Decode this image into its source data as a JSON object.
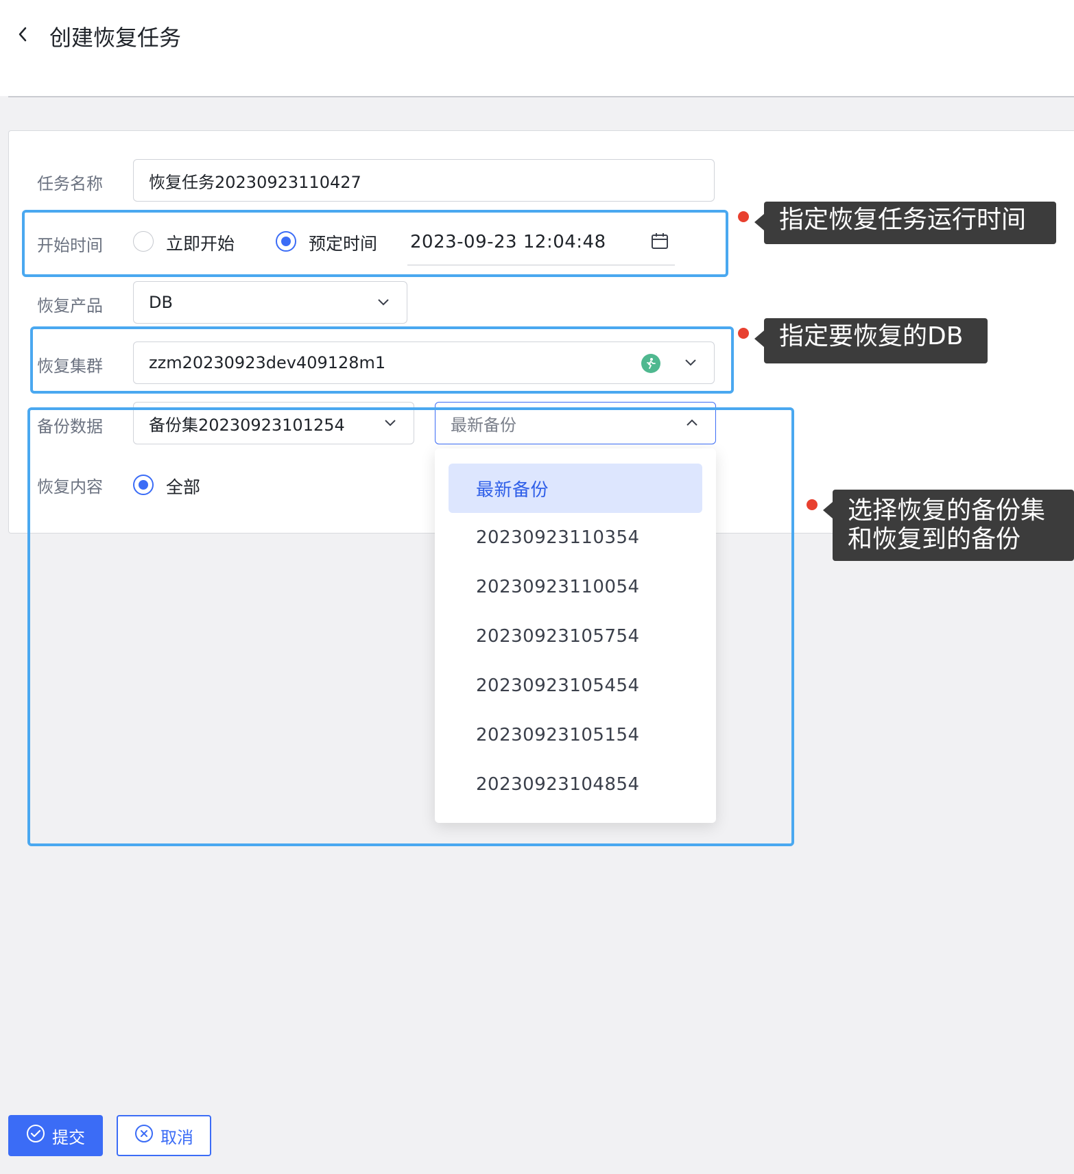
{
  "header": {
    "title": "创建恢复任务"
  },
  "form": {
    "task_name": {
      "label": "任务名称",
      "value": "恢复任务20230923110427"
    },
    "start_time": {
      "label": "开始时间",
      "option_now": "立即开始",
      "option_scheduled": "预定时间",
      "selected": "预定时间",
      "datetime": "2023-09-23 12:04:48"
    },
    "product": {
      "label": "恢复产品",
      "value": "DB"
    },
    "cluster": {
      "label": "恢复集群",
      "value": "zzm20230923dev409128m1"
    },
    "backup": {
      "label": "备份数据",
      "set_value": "备份集20230923101254",
      "target_value": "最新备份"
    },
    "content": {
      "label": "恢复内容",
      "option_all": "全部"
    }
  },
  "dropdown": {
    "items": [
      {
        "label": "最新备份",
        "selected": true
      },
      {
        "label": "20230923110354"
      },
      {
        "label": "20230923110054"
      },
      {
        "label": "20230923105754"
      },
      {
        "label": "20230923105454"
      },
      {
        "label": "20230923105154"
      },
      {
        "label": "20230923104854"
      }
    ]
  },
  "annotations": {
    "callout_1": "指定恢复任务运行时间",
    "callout_2": "指定要恢复的DB",
    "callout_3_line1": "选择恢复的备份集",
    "callout_3_line2": "和恢复到的备份",
    "highlight_color": "#4aa8f0",
    "dot_color": "#e8402f"
  },
  "footer": {
    "submit_label": "提交",
    "cancel_label": "取消"
  },
  "colors": {
    "primary": "#3b6cf6",
    "selected_bg": "#dde6fe"
  }
}
